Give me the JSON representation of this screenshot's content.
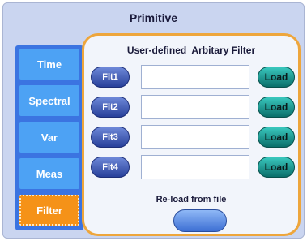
{
  "window": {
    "title": "Primitive"
  },
  "sidebar": {
    "items": [
      {
        "label": "Time",
        "active": false
      },
      {
        "label": "Spectral",
        "active": false
      },
      {
        "label": "Var",
        "active": false
      },
      {
        "label": "Meas",
        "active": false
      },
      {
        "label": "Filter",
        "active": true
      }
    ]
  },
  "panel": {
    "title": "User-defined  Arbitary Filter",
    "rows": [
      {
        "filter_label": "Flt1",
        "value": "",
        "load_label": "Load"
      },
      {
        "filter_label": "Flt2",
        "value": "",
        "load_label": "Load"
      },
      {
        "filter_label": "Flt3",
        "value": "",
        "load_label": "Load"
      },
      {
        "filter_label": "Flt4",
        "value": "",
        "load_label": "Load"
      }
    ],
    "reload_label": "Re-load from file",
    "reload_button_label": ""
  },
  "colors": {
    "accent_orange": "#f59218",
    "sidebar_blue": "#3b74e1",
    "button_blue": "#4da2f4",
    "load_teal": "#18a6a0"
  }
}
